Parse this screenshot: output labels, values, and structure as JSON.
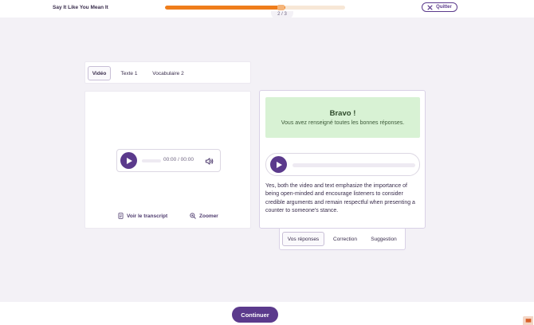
{
  "header": {
    "app_title": "Say It Like You Mean It",
    "progress_label": "2 / 3",
    "progress_fraction": 0.667,
    "quit_label": "Quitter"
  },
  "media_tabs": [
    {
      "label": "Vidéo",
      "active": true
    },
    {
      "label": "Texte 1",
      "active": false
    },
    {
      "label": "Vocabulaire 2",
      "active": false
    }
  ],
  "video_player": {
    "time": "00:00 / 00:00"
  },
  "media_actions": {
    "transcript_label": "Voir le transcript",
    "zoom_label": "Zoomer"
  },
  "result": {
    "title": "Bravo !",
    "message": "Vous avez renseigné toutes les bonnes réponses.",
    "answer_text": "Yes, both the video and text emphasize the importance of being open-minded and encourage listeners to consider credible arguments and remain respectful when presenting a counter to someone's stance."
  },
  "result_tabs": [
    {
      "label": "Vos réponses",
      "active": true
    },
    {
      "label": "Correction",
      "active": false
    },
    {
      "label": "Suggestion",
      "active": false
    }
  ],
  "footer": {
    "continue_label": "Continuer"
  },
  "colors": {
    "brand": "#5b3a8c",
    "progress": "#ef7d1b",
    "success_bg": "#d8f2d4"
  },
  "icons": {
    "quit": "close-icon",
    "play": "play-icon",
    "volume": "volume-icon",
    "transcript": "document-icon",
    "zoom": "zoom-icon",
    "help": "book-icon"
  }
}
